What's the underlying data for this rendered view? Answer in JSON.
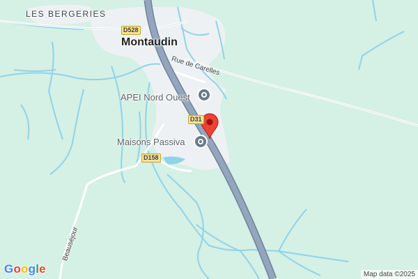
{
  "map": {
    "labels": {
      "town": "Montaudin",
      "district": "LES BERGERIES",
      "poi_1": "APEI Nord Ouest",
      "poi_2": "Maisons Passiva",
      "street_1": "Rue de Carelles",
      "street_2": "Beauséjour"
    },
    "road_shields": {
      "d528": "D528",
      "d31": "D31",
      "d158": "D158"
    },
    "branding": {
      "logo": [
        "G",
        "o",
        "o",
        "g",
        "l",
        "e"
      ],
      "logo_colors": [
        "#4285F4",
        "#EA4335",
        "#FBBC05",
        "#4285F4",
        "#34A853",
        "#EA4335"
      ],
      "attribution": "Map data ©2025"
    },
    "colors": {
      "land": "#d5f0e4",
      "water": "#8fd3e9",
      "highway": "#8a9bb1",
      "urban": "#eef1f3",
      "marker": "#ea4335"
    },
    "icons": [
      "poi-icon",
      "location-pin-icon"
    ]
  }
}
